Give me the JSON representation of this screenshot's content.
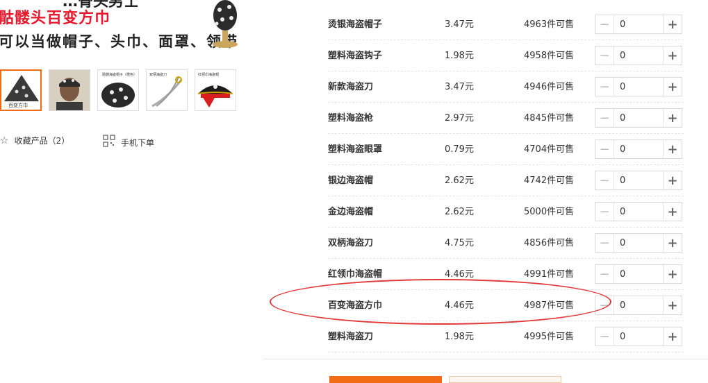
{
  "promo": {
    "line0": "…骨头男士",
    "line1": "骷髅头百变方巾",
    "line2": "可以当做帽子、头巾、面罩、领带"
  },
  "thumbnails": [
    {
      "label": "百变方巾"
    },
    {
      "label": ""
    },
    {
      "label": "骷髅海盗帽子（橙色）"
    },
    {
      "label": "双柄海盗刀"
    },
    {
      "label": "红领巾海盗帽"
    }
  ],
  "actions": {
    "favorite_label": "收藏产品（2）",
    "mobile_label": "手机下单"
  },
  "products": [
    {
      "name": "烫银海盗帽子",
      "price": "3.47元",
      "stock": "4963件可售",
      "qty": "0"
    },
    {
      "name": "塑料海盗钩子",
      "price": "1.98元",
      "stock": "4958件可售",
      "qty": "0"
    },
    {
      "name": "新款海盗刀",
      "price": "3.47元",
      "stock": "4946件可售",
      "qty": "0"
    },
    {
      "name": "塑料海盗枪",
      "price": "2.97元",
      "stock": "4845件可售",
      "qty": "0"
    },
    {
      "name": "塑料海盗眼罩",
      "price": "0.79元",
      "stock": "4704件可售",
      "qty": "0"
    },
    {
      "name": "银边海盗帽",
      "price": "2.62元",
      "stock": "4742件可售",
      "qty": "0"
    },
    {
      "name": "金边海盗帽",
      "price": "2.62元",
      "stock": "5000件可售",
      "qty": "0"
    },
    {
      "name": "双柄海盗刀",
      "price": "4.75元",
      "stock": "4856件可售",
      "qty": "0"
    },
    {
      "name": "红领巾海盗帽",
      "price": "4.46元",
      "stock": "4991件可售",
      "qty": "0"
    },
    {
      "name": "百变海盗方巾",
      "price": "4.46元",
      "stock": "4987件可售",
      "qty": "0"
    },
    {
      "name": "塑料海盗刀",
      "price": "1.98元",
      "stock": "4995件可售",
      "qty": "0"
    }
  ],
  "stepper": {
    "minus": "−",
    "plus": "+"
  },
  "colors": {
    "accent": "#f06b13",
    "annotation": "#e23a3a"
  }
}
